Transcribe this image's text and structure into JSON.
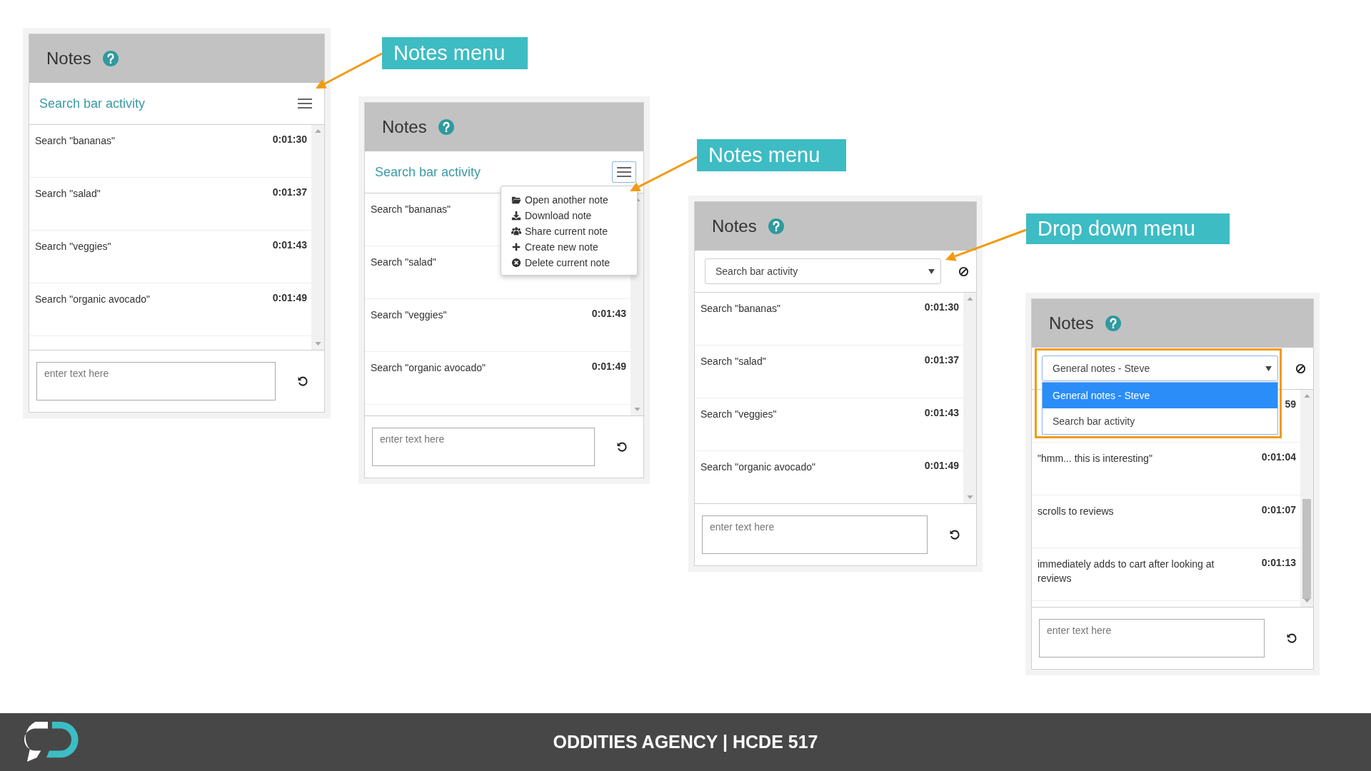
{
  "panels": [
    {
      "title": "Notes",
      "toolbar": {
        "kind": "label",
        "text": "Search bar activity",
        "menu_open": false
      },
      "rows": [
        {
          "text": "Search \"bananas\"",
          "time": "0:01:30"
        },
        {
          "text": "Search \"salad\"",
          "time": "0:01:37"
        },
        {
          "text": "Search \"veggies\"",
          "time": "0:01:43"
        },
        {
          "text": "Search \"organic avocado\"",
          "time": "0:01:49"
        }
      ],
      "scroll_thumb": false,
      "input": {
        "placeholder": "enter text here"
      }
    },
    {
      "title": "Notes",
      "toolbar": {
        "kind": "label",
        "text": "Search bar activity",
        "menu_open": true,
        "menu": [
          "Open another note",
          "Download note",
          "Share current note",
          "Create new note",
          "Delete current note"
        ]
      },
      "rows": [
        {
          "text": "Search \"bananas\""
        },
        {
          "text": "Search \"salad\""
        },
        {
          "text": "Search \"veggies\"",
          "time": "0:01:43"
        },
        {
          "text": "Search \"organic avocado\"",
          "time": "0:01:49"
        }
      ],
      "scroll_thumb": false,
      "input": {
        "placeholder": "enter text here"
      }
    },
    {
      "title": "Notes",
      "toolbar": {
        "kind": "select",
        "value": "Search bar activity",
        "open": false,
        "highlighted": false
      },
      "rows": [
        {
          "text": "Search \"bananas\"",
          "time": "0:01:30"
        },
        {
          "text": "Search \"salad\"",
          "time": "0:01:37"
        },
        {
          "text": "Search \"veggies\"",
          "time": "0:01:43"
        },
        {
          "text": "Search \"organic avocado\"",
          "time": "0:01:49"
        }
      ],
      "scroll_thumb": false,
      "input": {
        "placeholder": "enter text here"
      }
    },
    {
      "title": "Notes",
      "toolbar": {
        "kind": "select",
        "value": "General notes - Steve",
        "open": true,
        "highlighted": true,
        "options": [
          {
            "label": "General notes - Steve",
            "selected": true
          },
          {
            "label": "Search bar activity",
            "selected": false
          }
        ]
      },
      "rows": [
        {
          "time": "59"
        },
        {
          "text": "\"hmm... this is interesting\"",
          "time": "0:01:04"
        },
        {
          "text": "scrolls to reviews",
          "time": "0:01:07"
        },
        {
          "text": "immediately adds to cart after looking at reviews",
          "time": "0:01:13"
        }
      ],
      "scroll_thumb": true,
      "input": {
        "placeholder": "enter text here"
      }
    }
  ],
  "callouts": [
    {
      "text": "Notes menu"
    },
    {
      "text": "Notes menu"
    },
    {
      "text": "Drop down menu"
    }
  ],
  "footer": {
    "title": "ODDITIES AGENCY | HCDE 517"
  }
}
